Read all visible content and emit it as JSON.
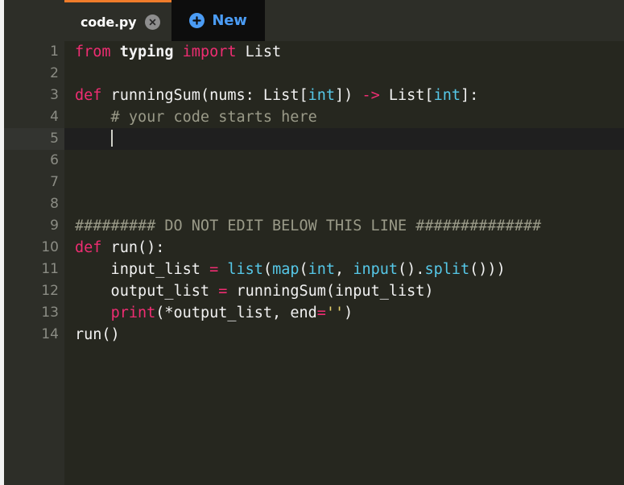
{
  "window": {
    "accent_orange": "#f07c2b",
    "accent_blue": "#4b9cf5",
    "gutter_bg": "#2d2e28",
    "code_bg": "#26271f",
    "active_line_bg": "#1f1f1f",
    "keyword_color": "#ef2d72",
    "builtin_color": "#56c8e8",
    "string_color": "#e6d06c",
    "comment_color": "#9a9a88"
  },
  "tabbar": {
    "tabs": [
      {
        "label": "code.py",
        "close_icon": "close-circle-icon",
        "active": true
      }
    ],
    "new_tab": {
      "label": "New",
      "icon": "plus-circle-icon"
    }
  },
  "editor": {
    "filename": "code.py",
    "language": "python",
    "cursor_line": 5,
    "cursor_column": 5,
    "total_lines": 14,
    "fold_lines": [
      3,
      10
    ],
    "lines": [
      {
        "n": "1",
        "tokens": [
          {
            "t": "from",
            "c": "kw"
          },
          {
            "t": " ",
            "c": "id"
          },
          {
            "t": "typing",
            "c": "id-bold"
          },
          {
            "t": " ",
            "c": "id"
          },
          {
            "t": "import",
            "c": "kw"
          },
          {
            "t": " ",
            "c": "id"
          },
          {
            "t": "List",
            "c": "id"
          }
        ]
      },
      {
        "n": "2",
        "tokens": []
      },
      {
        "n": "3",
        "tokens": [
          {
            "t": "def",
            "c": "kw"
          },
          {
            "t": " runningSum(nums: List[",
            "c": "id"
          },
          {
            "t": "int",
            "c": "bi"
          },
          {
            "t": "]) ",
            "c": "id"
          },
          {
            "t": "->",
            "c": "op"
          },
          {
            "t": " List[",
            "c": "id"
          },
          {
            "t": "int",
            "c": "bi"
          },
          {
            "t": "]:",
            "c": "id"
          }
        ]
      },
      {
        "n": "4",
        "tokens": [
          {
            "t": "    # your code starts here",
            "c": "cm"
          }
        ]
      },
      {
        "n": "5",
        "tokens": [
          {
            "t": "    ",
            "c": "id"
          }
        ],
        "caret": true
      },
      {
        "n": "6",
        "tokens": []
      },
      {
        "n": "7",
        "tokens": []
      },
      {
        "n": "8",
        "tokens": []
      },
      {
        "n": "9",
        "tokens": [
          {
            "t": "######### DO NOT EDIT BELOW THIS LINE ##############",
            "c": "cm"
          }
        ]
      },
      {
        "n": "10",
        "tokens": [
          {
            "t": "def",
            "c": "kw"
          },
          {
            "t": " run():",
            "c": "id"
          }
        ]
      },
      {
        "n": "11",
        "tokens": [
          {
            "t": "    input_list ",
            "c": "id"
          },
          {
            "t": "=",
            "c": "op"
          },
          {
            "t": " ",
            "c": "id"
          },
          {
            "t": "list",
            "c": "bi"
          },
          {
            "t": "(",
            "c": "id"
          },
          {
            "t": "map",
            "c": "bi"
          },
          {
            "t": "(",
            "c": "id"
          },
          {
            "t": "int",
            "c": "bi"
          },
          {
            "t": ", ",
            "c": "id"
          },
          {
            "t": "input",
            "c": "bi"
          },
          {
            "t": "().",
            "c": "id"
          },
          {
            "t": "split",
            "c": "bi"
          },
          {
            "t": "()))",
            "c": "id"
          }
        ]
      },
      {
        "n": "12",
        "tokens": [
          {
            "t": "    output_list ",
            "c": "id"
          },
          {
            "t": "=",
            "c": "op"
          },
          {
            "t": " runningSum(input_list)",
            "c": "id"
          }
        ]
      },
      {
        "n": "13",
        "tokens": [
          {
            "t": "    ",
            "c": "id"
          },
          {
            "t": "print",
            "c": "kw"
          },
          {
            "t": "(*output_list, end",
            "c": "id"
          },
          {
            "t": "=",
            "c": "op"
          },
          {
            "t": "''",
            "c": "str"
          },
          {
            "t": ")",
            "c": "id"
          }
        ]
      },
      {
        "n": "14",
        "tokens": [
          {
            "t": "run()",
            "c": "id"
          }
        ]
      }
    ]
  }
}
